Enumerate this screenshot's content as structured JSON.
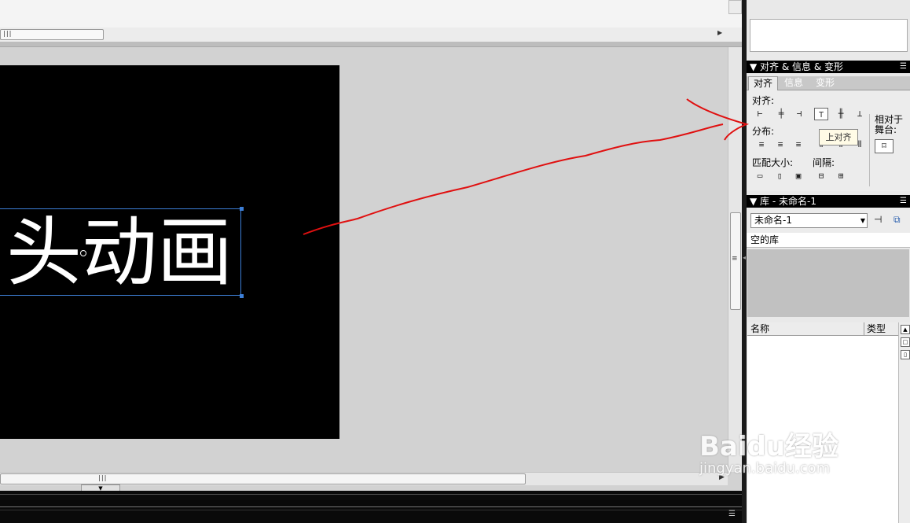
{
  "stage": {
    "text": "头动画"
  },
  "align_panel": {
    "title": "▼ 对齐 & 信息 & 变形",
    "menu_icon": "menu-icon",
    "tabs": [
      {
        "label": "对齐"
      },
      {
        "label": "信息"
      },
      {
        "label": "变形"
      }
    ],
    "sections": {
      "align": "对齐:",
      "distribute": "分布:",
      "match_size": "匹配大小:",
      "spacing": "间隔:",
      "to_stage_line1": "相对于",
      "to_stage_line2": "舞台:"
    },
    "tooltip": "上对齐"
  },
  "library_panel": {
    "title": "▼ 库 - 未命名-1",
    "doc_select": "未命名-1",
    "empty_label": "空的库",
    "columns": {
      "name": "名称",
      "type": "类型"
    }
  },
  "watermark": {
    "main": "Baidu经验",
    "sub": "jingyan.baidu.com"
  },
  "colors": {
    "stage": "#000000",
    "selection": "#3d7fd7",
    "annotation": "#e01010"
  }
}
